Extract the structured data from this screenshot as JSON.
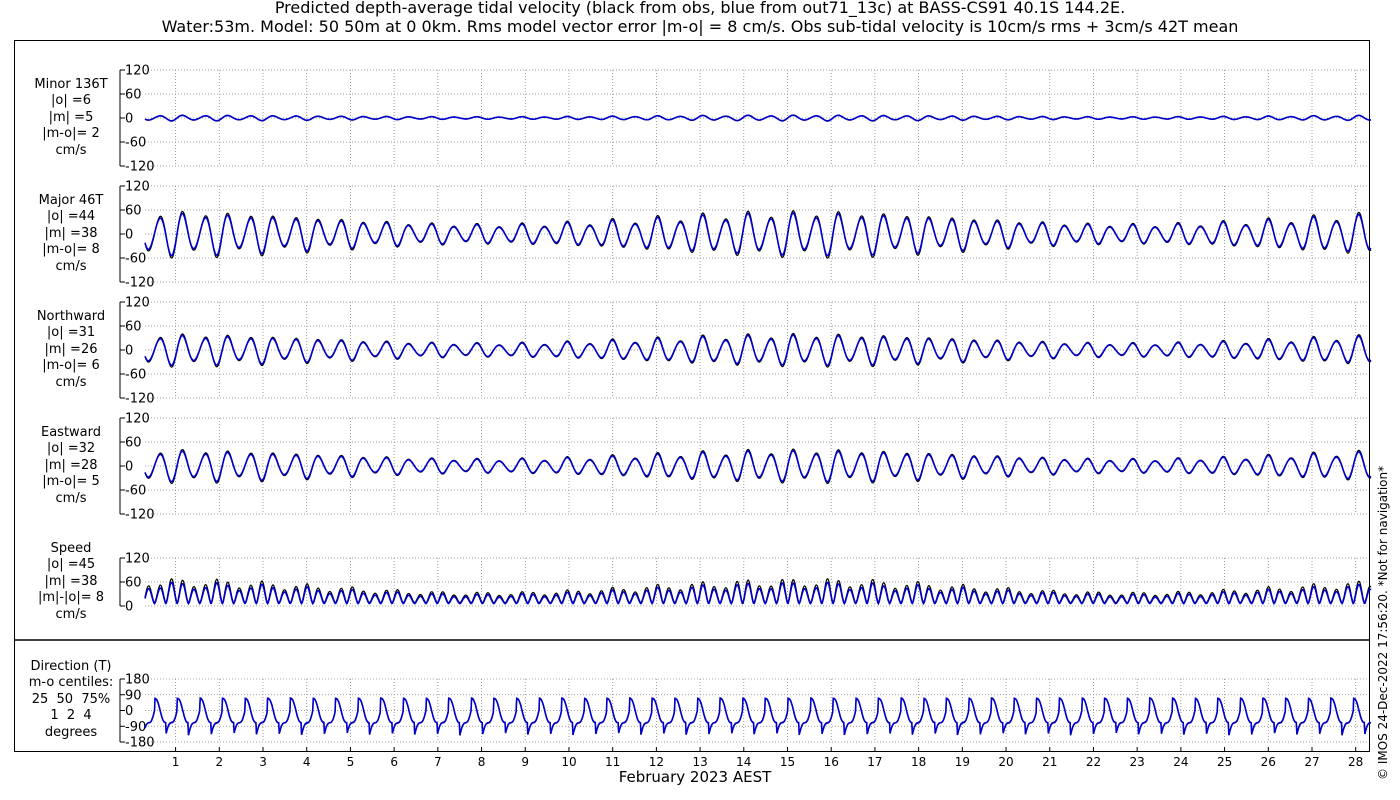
{
  "title_line1": "Predicted depth-average tidal velocity (black from obs, blue from out71_13c) at BASS-CS91 40.1S 144.2E.",
  "title_line2": "Water:53m. Model: 50 50m at 0 0km. Rms model vector error |m-o| = 8 cm/s. Obs sub-tidal velocity is 10cm/s rms + 3cm/s 42T mean",
  "xlabel": "February 2023 AEST",
  "credit": "© IMOS 24-Dec-2022 17:56:20. *Not for navigation*",
  "colors": {
    "obs": "#000000",
    "model": "#0000cc",
    "grid": "#666666"
  },
  "panels": [
    {
      "id": "minor",
      "label": "Minor 136T\n|o| =6\n|m| =5\n|m-o|= 2\ncm/s",
      "yticks": [
        120,
        60,
        0,
        -60,
        -120
      ],
      "ylim": [
        -120,
        120
      ],
      "amp": 8
    },
    {
      "id": "major",
      "label": "Major 46T\n|o| =44\n|m| =38\n|m-o|= 8\ncm/s",
      "yticks": [
        120,
        60,
        0,
        -60,
        -120
      ],
      "ylim": [
        -120,
        120
      ],
      "amp": 62
    },
    {
      "id": "north",
      "label": "Northward\n|o| =31\n|m| =26\n|m-o|= 6\ncm/s",
      "yticks": [
        120,
        60,
        0,
        -60,
        -120
      ],
      "ylim": [
        -120,
        120
      ],
      "amp": 44
    },
    {
      "id": "east",
      "label": "Eastward\n|o| =32\n|m| =28\n|m-o|= 5\ncm/s",
      "yticks": [
        120,
        60,
        0,
        -60,
        -120
      ],
      "ylim": [
        -120,
        120
      ],
      "amp": 45
    },
    {
      "id": "speed",
      "label": "Speed\n|o| =45\n|m| =38\n|m|-|o|= 8\ncm/s",
      "yticks": [
        120,
        60,
        0
      ],
      "ylim": [
        0,
        120
      ],
      "amp": 62
    },
    {
      "id": "direction",
      "label": "Direction (T)\nm-o centiles:\n25  50  75%\n1  2  4\ndegrees",
      "yticks": [
        180,
        90,
        0,
        -90,
        -180
      ],
      "ylim": [
        -180,
        180
      ]
    }
  ],
  "chart_data": {
    "type": "line",
    "xlabel": "February 2023 AEST",
    "x_ticks": [
      "1",
      "2",
      "3",
      "4",
      "5",
      "6",
      "7",
      "8",
      "9",
      "10",
      "11",
      "12",
      "13",
      "14",
      "15",
      "16",
      "17",
      "18",
      "19",
      "20",
      "21",
      "22",
      "23",
      "24",
      "25",
      "26",
      "27",
      "28"
    ],
    "xlim_days": [
      0.3,
      28.35
    ],
    "series": [
      {
        "name": "black from obs"
      },
      {
        "name": "blue from out71_13c"
      }
    ],
    "tidal_period_hours": 12.42,
    "summary": {
      "minor_136T": {
        "o": 6,
        "m": 5,
        "m_minus_o": 2
      },
      "major_46T": {
        "o": 44,
        "m": 38,
        "m_minus_o": 8
      },
      "northward": {
        "o": 31,
        "m": 26,
        "m_minus_o": 6
      },
      "eastward": {
        "o": 32,
        "m": 28,
        "m_minus_o": 5
      },
      "speed": {
        "o": 45,
        "m": 38,
        "abs_m_minus_abs_o": 8
      },
      "direction_centiles_deg": {
        "25": 1,
        "50": 2,
        "75": 4
      }
    }
  }
}
